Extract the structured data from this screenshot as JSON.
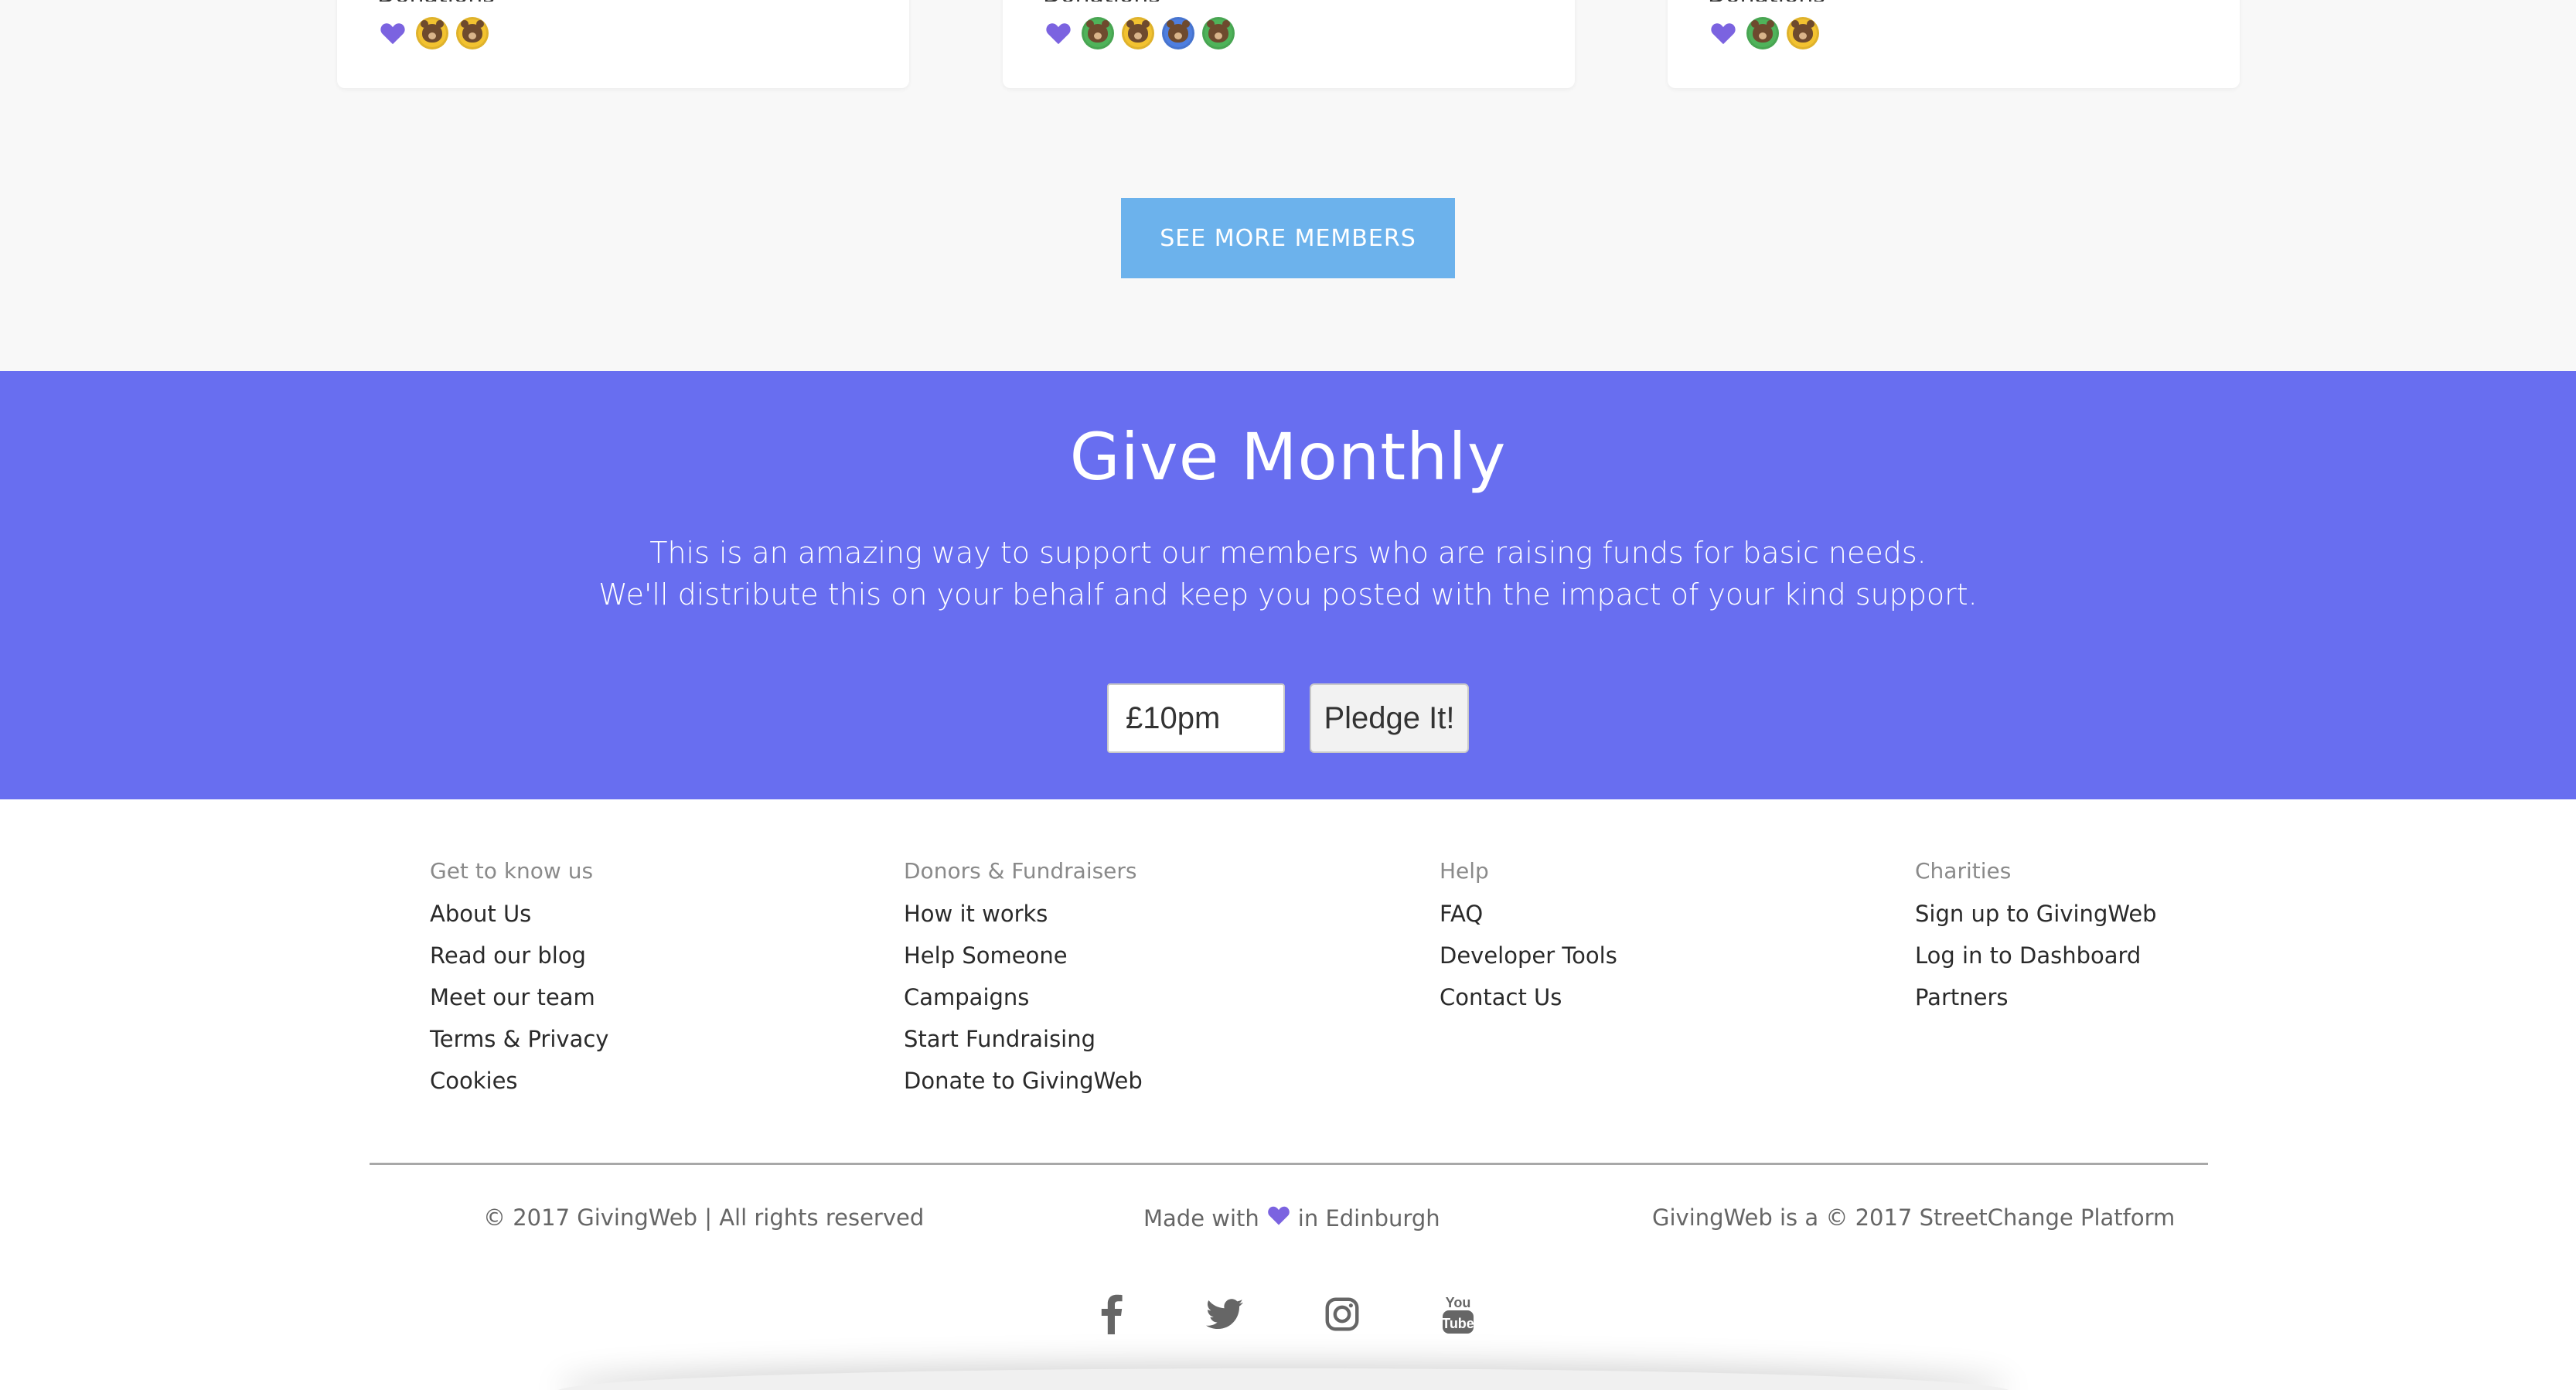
{
  "members": {
    "cards": [
      {
        "label": "Donations",
        "coins": [
          "#f2c230",
          "#f2c230"
        ]
      },
      {
        "label": "Donations",
        "coins": [
          "#4fb35a",
          "#f2c230",
          "#4e7ee0",
          "#4fb35a"
        ]
      },
      {
        "label": "Donations",
        "coins": [
          "#4fb35a",
          "#f2c230"
        ]
      }
    ],
    "see_more_label": "SEE MORE MEMBERS"
  },
  "give_monthly": {
    "title": "Give Monthly",
    "line1": "This is an amazing way to support our members who are raising funds for basic needs.",
    "line2": "We'll distribute this on your behalf and keep you posted with the impact of your kind support.",
    "amount_value": "£10pm",
    "pledge_label": "Pledge It!"
  },
  "footer": {
    "columns": [
      {
        "heading": "Get to know us",
        "links": [
          "About Us",
          "Read our blog",
          "Meet our team",
          "Terms & Privacy",
          "Cookies"
        ]
      },
      {
        "heading": "Donors & Fundraisers",
        "links": [
          "How it works",
          "Help Someone",
          "Campaigns",
          "Start Fundraising",
          "Donate to GivingWeb"
        ]
      },
      {
        "heading": "Help",
        "links": [
          "FAQ",
          "Developer Tools",
          "Contact Us"
        ]
      },
      {
        "heading": "Charities",
        "links": [
          "Sign up to GivingWeb",
          "Log in to Dashboard",
          "Partners"
        ]
      }
    ],
    "copyright": "© 2017 GivingWeb | All rights reserved",
    "made_with_prefix": "Made with",
    "made_with_suffix": "in Edinburgh",
    "platform": "GivingWeb is a © 2017 StreetChange Platform",
    "socials": [
      "facebook-icon",
      "twitter-icon",
      "instagram-icon",
      "youtube-icon"
    ]
  },
  "colors": {
    "accent_purple": "#686ef0",
    "button_blue": "#6cb2ec",
    "heart": "#7b63e0"
  }
}
